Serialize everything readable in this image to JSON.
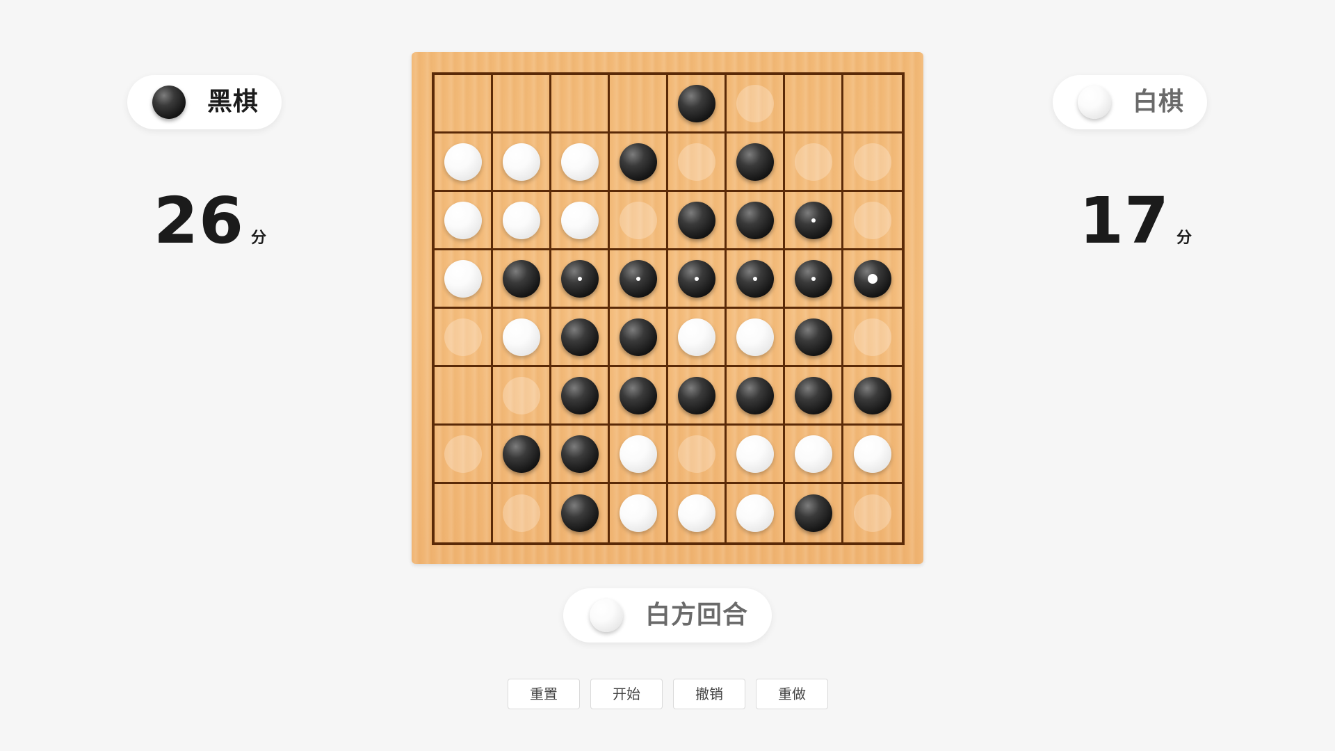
{
  "players": {
    "black": {
      "label": "黑棋",
      "score": "26",
      "unit": "分"
    },
    "white": {
      "label": "白棋",
      "score": "17",
      "unit": "分"
    }
  },
  "turn": {
    "label": "白方回合",
    "stone": "white"
  },
  "controls": {
    "reset": "重置",
    "start": "开始",
    "undo": "撤销",
    "redo": "重做"
  },
  "board": {
    "size": 8,
    "legend": "B = black stone, W = white stone, h = hint (valid move), . = empty, b = black with small dot (flipped), m = black with large dot (last move)",
    "rows": [
      "....Bh..",
      "WWWBhBhh",
      "WWWhBBbh",
      "WBbbbbbm",
      "hWBBWWBh",
      ".hBBBBBB",
      "hBBWhWWW",
      ".hBWWWBh"
    ]
  },
  "colors": {
    "background": "#f6f6f6",
    "board_wood": "#f2b977",
    "grid_line": "#5a2a08",
    "black_stone": "#1a1a1a",
    "white_stone": "#f5f5f5"
  }
}
